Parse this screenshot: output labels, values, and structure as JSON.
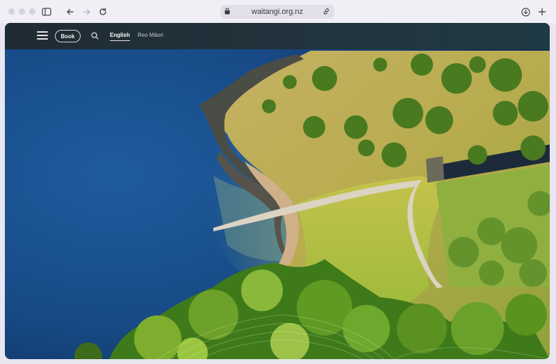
{
  "browser": {
    "url": "waitangi.org.nz",
    "icons": {
      "sidebar": "sidebar-icon",
      "back": "back-arrow-icon",
      "forward": "forward-arrow-icon",
      "reload": "reload-icon",
      "lock": "lock-icon",
      "share": "link-icon",
      "downloads": "download-icon",
      "new_tab": "plus-icon"
    }
  },
  "site": {
    "header": {
      "menu_icon": "hamburger-icon",
      "book_label": "Book",
      "search_icon": "search-icon",
      "languages": [
        {
          "label": "English",
          "active": true
        },
        {
          "label": "Reo Māori",
          "active": false
        }
      ]
    },
    "hero": {
      "image": "aerial-coastline-photo",
      "colors": {
        "sea_deep": "#14386e",
        "sea_shallow": "#5c8a86",
        "grass": "#b9ab4f",
        "trees": "#4d8a1e"
      }
    }
  }
}
